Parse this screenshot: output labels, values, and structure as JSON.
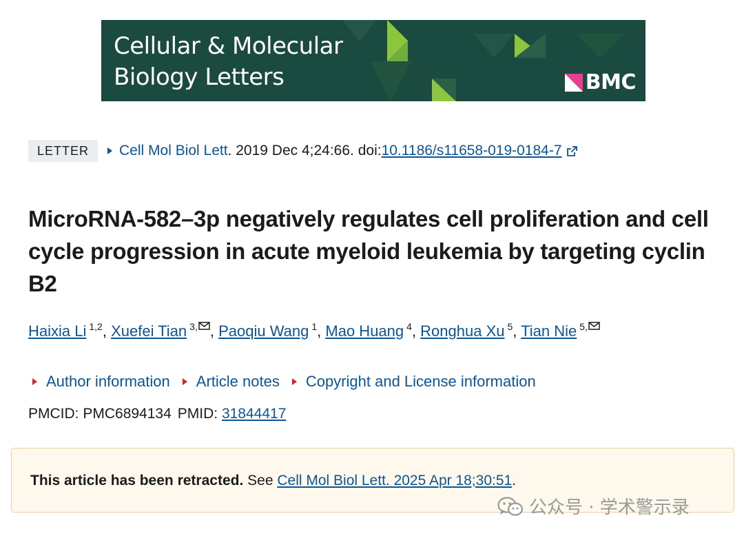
{
  "journal_banner": {
    "title_line1": "Cellular & Molecular",
    "title_line2": "Biology Letters",
    "publisher": "BMC",
    "colors": {
      "background": "#1b4a40",
      "accent": "#8cc63f"
    }
  },
  "citation": {
    "badge": "LETTER",
    "journal_link": "Cell Mol Biol Lett",
    "details": ". 2019 Dec 4;24:66. doi: ",
    "doi": "10.1186/s11658-019-0184-7"
  },
  "article": {
    "title": "MicroRNA-582–3p negatively regulates cell proliferation and cell cycle progression in acute myeloid leukemia by targeting cyclin B2"
  },
  "authors": [
    {
      "name": "Haixia Li",
      "affil": "1,2",
      "mail": false
    },
    {
      "name": "Xuefei Tian",
      "affil": "3,",
      "mail": true
    },
    {
      "name": "Paoqiu Wang",
      "affil": "1",
      "mail": false
    },
    {
      "name": "Mao Huang",
      "affil": "4",
      "mail": false
    },
    {
      "name": "Ronghua Xu",
      "affil": "5",
      "mail": false
    },
    {
      "name": "Tian Nie",
      "affil": "5,",
      "mail": true
    }
  ],
  "toggles": {
    "author_info": "Author information",
    "article_notes": "Article notes",
    "copyright": "Copyright and License information"
  },
  "ids": {
    "pmcid_label": "PMCID: ",
    "pmcid": "PMC6894134",
    "pmid_label": "PMID: ",
    "pmid": "31844417"
  },
  "notice": {
    "bold": "This article has been retracted.",
    "see": " See ",
    "link": "Cell Mol Biol Lett. 2025 Apr 18;30:51",
    "end": "."
  },
  "watermark": {
    "text": "公众号 · 学术警示录"
  },
  "colors": {
    "link": "#0b5596",
    "toggle_arrow": "#d5262b",
    "notice_bg": "#fef9ec",
    "notice_border": "#e8cfa4",
    "badge_bg": "#e9eef3"
  }
}
